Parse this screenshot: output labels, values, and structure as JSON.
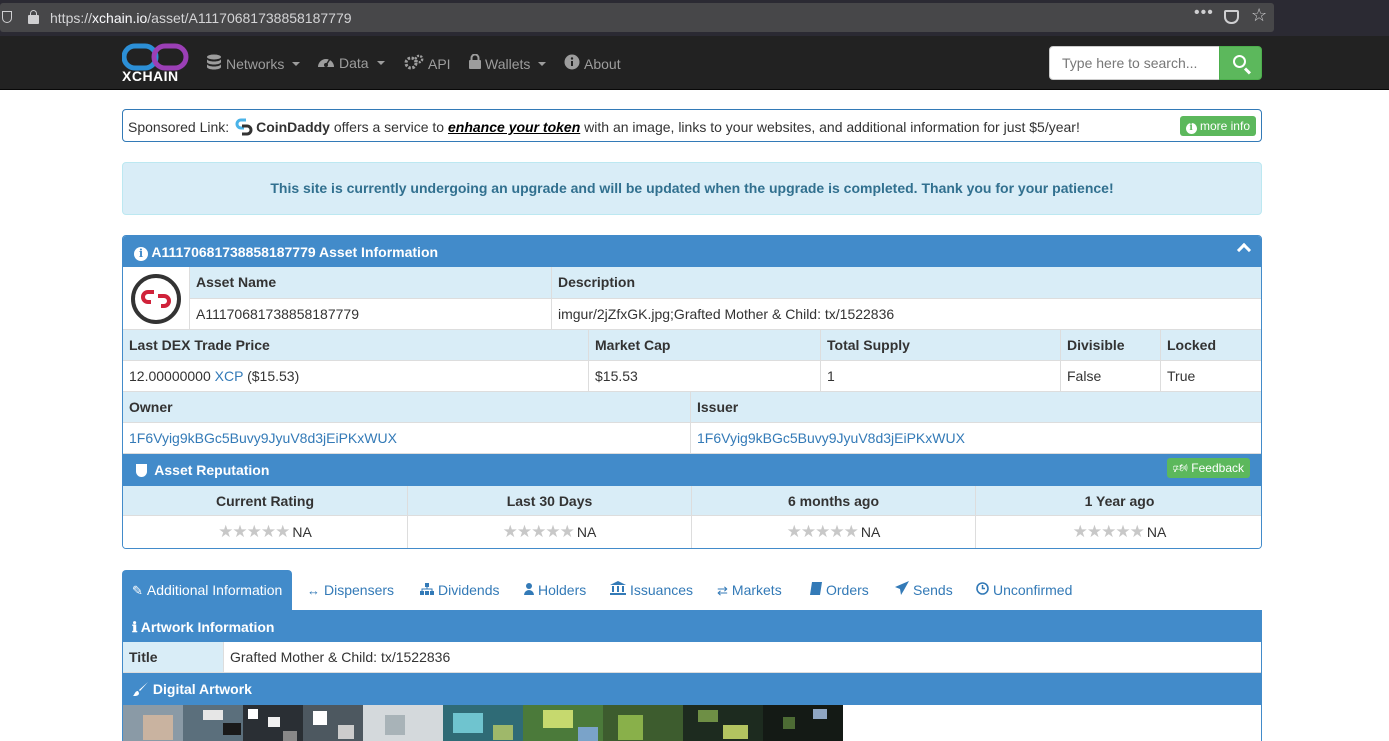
{
  "browser": {
    "url_prefix": "https://",
    "url_host": "xchain.io",
    "url_path": "/asset/A11170681738858187779"
  },
  "navbar": {
    "logo_text": "XCHAIN",
    "items": [
      {
        "label": "Networks",
        "icon": "database-icon",
        "dropdown": true
      },
      {
        "label": "Data",
        "icon": "dashboard-icon",
        "dropdown": true
      },
      {
        "label": "API",
        "icon": "gears-icon",
        "dropdown": false
      },
      {
        "label": "Wallets",
        "icon": "lock-icon",
        "dropdown": true
      },
      {
        "label": "About",
        "icon": "info-circle-icon",
        "dropdown": false
      }
    ],
    "search_placeholder": "Type here to search..."
  },
  "sponsored": {
    "prefix": "Sponsored Link:",
    "brand": "CoinDaddy",
    "text1": "offers a service to",
    "emph": "enhance your token",
    "text2": "with an image, links to your websites, and additional information for just $5/year!",
    "button": "more info"
  },
  "alert": {
    "text": "This site is currently undergoing an upgrade and will be updated when the upgrade is completed. Thank you for your patience!"
  },
  "asset": {
    "panel_title": "A11170681738858187779 Asset Information",
    "name_label": "Asset Name",
    "name_value": "A11170681738858187779",
    "desc_label": "Description",
    "desc_value": "imgur/2jZfxGK.jpg;Grafted Mother & Child: tx/1522836",
    "price_label": "Last DEX Trade Price",
    "price_value": "12.00000000",
    "price_unit": "XCP",
    "price_usd": "($15.53)",
    "mcap_label": "Market Cap",
    "mcap_value": "$15.53",
    "supply_label": "Total Supply",
    "supply_value": "1",
    "divisible_label": "Divisible",
    "divisible_value": "False",
    "locked_label": "Locked",
    "locked_value": "True",
    "owner_label": "Owner",
    "owner_value": "1F6Vyig9kBGc5Buvy9JyuV8d3jEiPKxWUX",
    "issuer_label": "Issuer",
    "issuer_value": "1F6Vyig9kBGc5Buvy9JyuV8d3jEiPKxWUX"
  },
  "reputation": {
    "title": "Asset Reputation",
    "feedback_button": "Feedback",
    "columns": [
      {
        "label": "Current Rating",
        "value": "NA"
      },
      {
        "label": "Last 30 Days",
        "value": "NA"
      },
      {
        "label": "6 months ago",
        "value": "NA"
      },
      {
        "label": "1 Year ago",
        "value": "NA"
      }
    ]
  },
  "tabs": [
    {
      "label": "Additional Information",
      "icon": "pencil-icon"
    },
    {
      "label": "Dispensers",
      "icon": "arrows-h-icon"
    },
    {
      "label": "Dividends",
      "icon": "sitemap-icon"
    },
    {
      "label": "Holders",
      "icon": "user-icon"
    },
    {
      "label": "Issuances",
      "icon": "bank-icon"
    },
    {
      "label": "Markets",
      "icon": "exchange-icon"
    },
    {
      "label": "Orders",
      "icon": "book-icon"
    },
    {
      "label": "Sends",
      "icon": "send-icon"
    },
    {
      "label": "Unconfirmed",
      "icon": "clock-icon"
    }
  ],
  "artwork": {
    "title": "Artwork Information",
    "title_label": "Title",
    "title_value": "Grafted Mother & Child: tx/1522836",
    "digital_title": "Digital Artwork"
  },
  "colors": {
    "primary": "#428bca",
    "success": "#5cb85c",
    "navbar": "#222222",
    "info_bg": "#d9edf7",
    "info_text": "#31708f",
    "link": "#337ab7"
  }
}
